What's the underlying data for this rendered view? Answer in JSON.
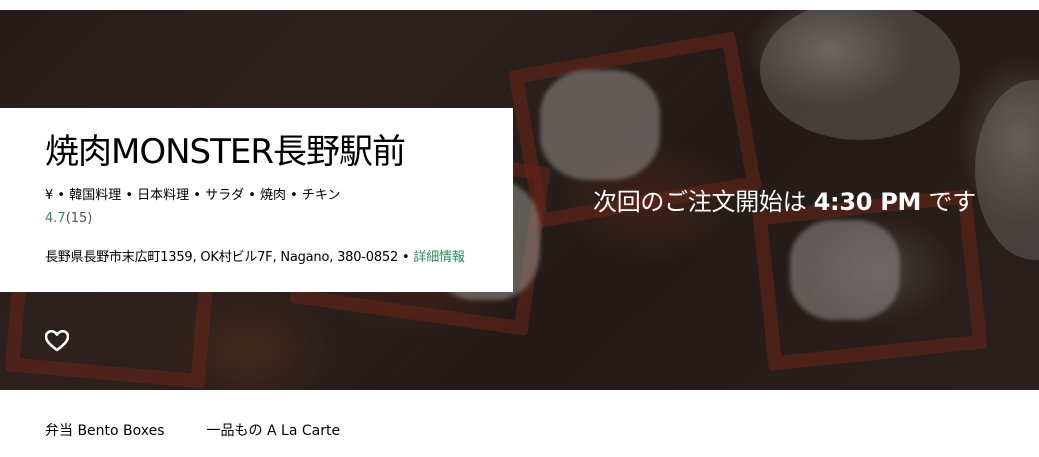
{
  "store": {
    "name": "焼肉MONSTER長野駅前",
    "categories": "¥ • 韓国料理 • 日本料理 • サラダ • 焼肉 • チキン",
    "rating_score": "4.7",
    "rating_count": "(15)",
    "address": "長野県長野市末広町1359, OK村ビル7F, Nagano, 380-0852 • ",
    "details_link": "詳細情報"
  },
  "schedule": {
    "prefix": "次回のご注文開始は ",
    "time": "4:30 PM",
    "suffix": " です"
  },
  "favorite": {
    "icon": "heart-outline-icon"
  },
  "menu": {
    "tabs": [
      {
        "label": "弁当 Bento Boxes"
      },
      {
        "label": "一品もの A La Carte"
      }
    ]
  },
  "colors": {
    "rating_green": "#3b8a5a",
    "link_green": "#2e8b57",
    "card_bg": "#ffffff"
  }
}
